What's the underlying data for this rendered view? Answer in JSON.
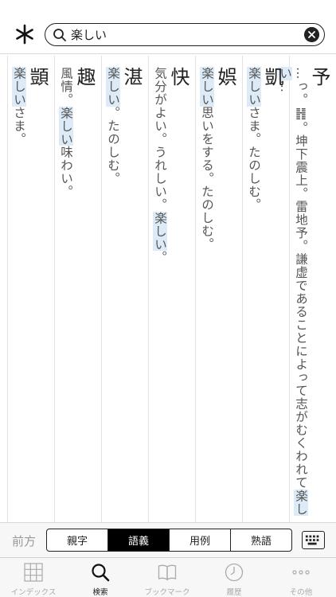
{
  "search": {
    "query": "楽しい",
    "placeholder": ""
  },
  "entries": [
    {
      "head": "予",
      "def_pre": "…っ。䷏。坤下震上。雷地予。謙虚であることによって志がむくわれて",
      "def_hl": "楽しい",
      "def_post": "…"
    },
    {
      "head": "凱",
      "def_pre": "",
      "def_hl": "楽しい",
      "def_post": "さま。たのしむ。"
    },
    {
      "head": "娯",
      "def_pre": "",
      "def_hl": "楽しい",
      "def_post": "思いをする。たのしむ。"
    },
    {
      "head": "快",
      "def_pre": "気分がよい。うれしい。",
      "def_hl": "楽しい",
      "def_post": "。"
    },
    {
      "head": "湛",
      "def_pre": "",
      "def_hl": "楽しい",
      "def_post": "。たのしむ。"
    },
    {
      "head": "趣",
      "def_pre": "風情。",
      "def_hl": "楽しい",
      "def_post": "味わい。"
    },
    {
      "head": "顗",
      "def_pre": "",
      "def_hl": "楽しい",
      "def_post": "さま。"
    }
  ],
  "nav": {
    "prev": "前方",
    "segments": [
      "親字",
      "語義",
      "用例",
      "熟語"
    ],
    "active_segment": "語義"
  },
  "tabs": [
    {
      "label": "インデックス",
      "icon": "grid-icon"
    },
    {
      "label": "検索",
      "icon": "search-icon"
    },
    {
      "label": "ブックマーク",
      "icon": "book-icon"
    },
    {
      "label": "履歴",
      "icon": "clock-icon"
    },
    {
      "label": "その他",
      "icon": "more-icon"
    }
  ],
  "active_tab": "検索",
  "colors": {
    "highlight": "#dcebf7",
    "active_segment_bg": "#000000"
  }
}
